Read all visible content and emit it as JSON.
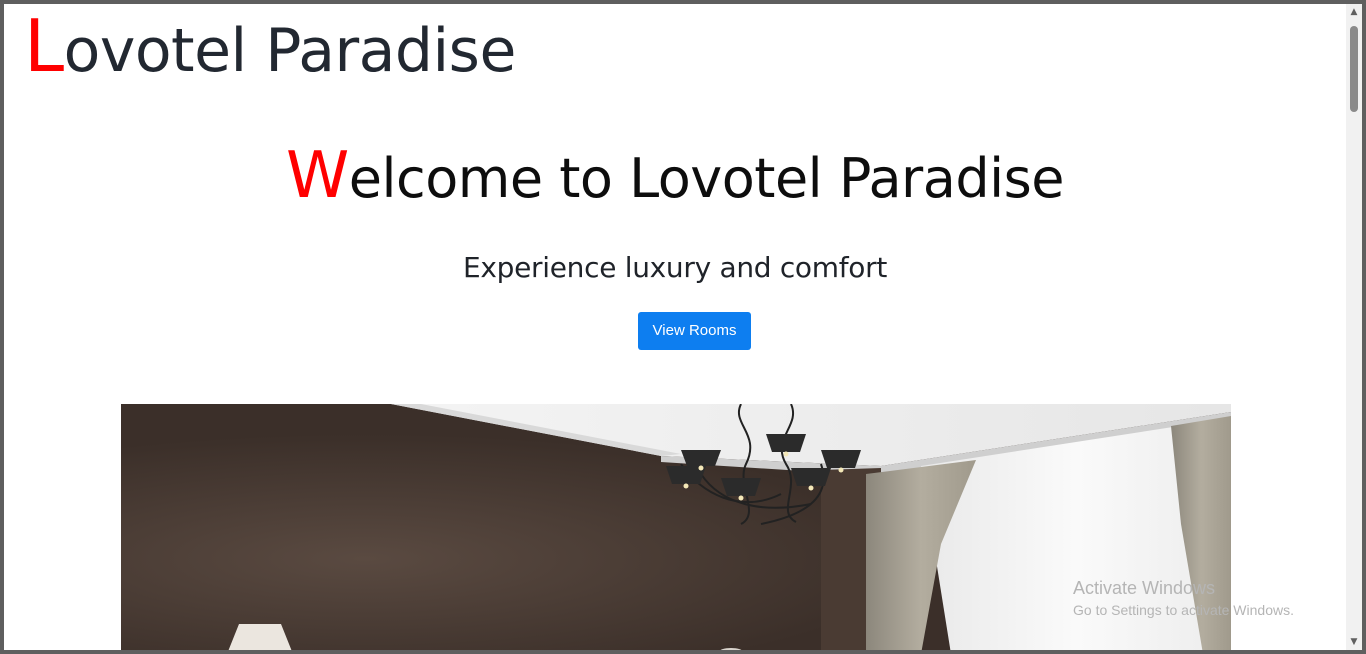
{
  "header": {
    "brand_first": "L",
    "brand_rest": "ovotel Paradise"
  },
  "hero": {
    "welcome_first": "W",
    "welcome_rest": "elcome to Lovotel Paradise",
    "tagline": "Experience luxury and comfort",
    "cta_label": "View Rooms"
  },
  "image": {
    "alt": "Hotel room interior with chandelier and curtains"
  },
  "watermark": {
    "title": "Activate Windows",
    "subtitle": "Go to Settings to activate Windows."
  },
  "scrollbar": {
    "up_icon": "▲",
    "down_icon": "▼"
  },
  "colors": {
    "accent_letter": "#ff0000",
    "button": "#0d7ef0",
    "text": "#222831"
  }
}
